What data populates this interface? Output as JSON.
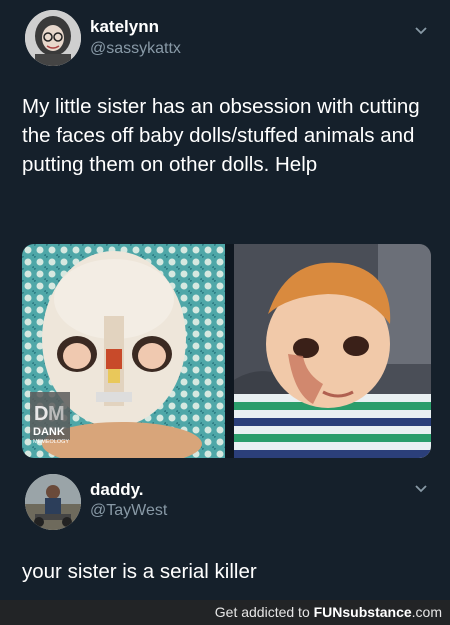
{
  "tweet1": {
    "display_name": "katelynn",
    "handle": "@sassykattx",
    "body": "My little sister has an obsession with cutting the faces off baby dolls/stuffed animals and putting them on other dolls. Help",
    "watermark_brand": "DANK",
    "watermark_sub": "MEMEOLOGY"
  },
  "tweet2": {
    "display_name": "daddy.",
    "handle": "@TayWest",
    "body": "your sister is a serial killer"
  },
  "footer": {
    "prefix": "Get addicted to",
    "brand": "FUNsubstance",
    "suffix": ".com"
  },
  "icons": [
    "chevron-down-icon",
    "avatar-photo",
    "doll-photo-left",
    "doll-photo-right"
  ]
}
